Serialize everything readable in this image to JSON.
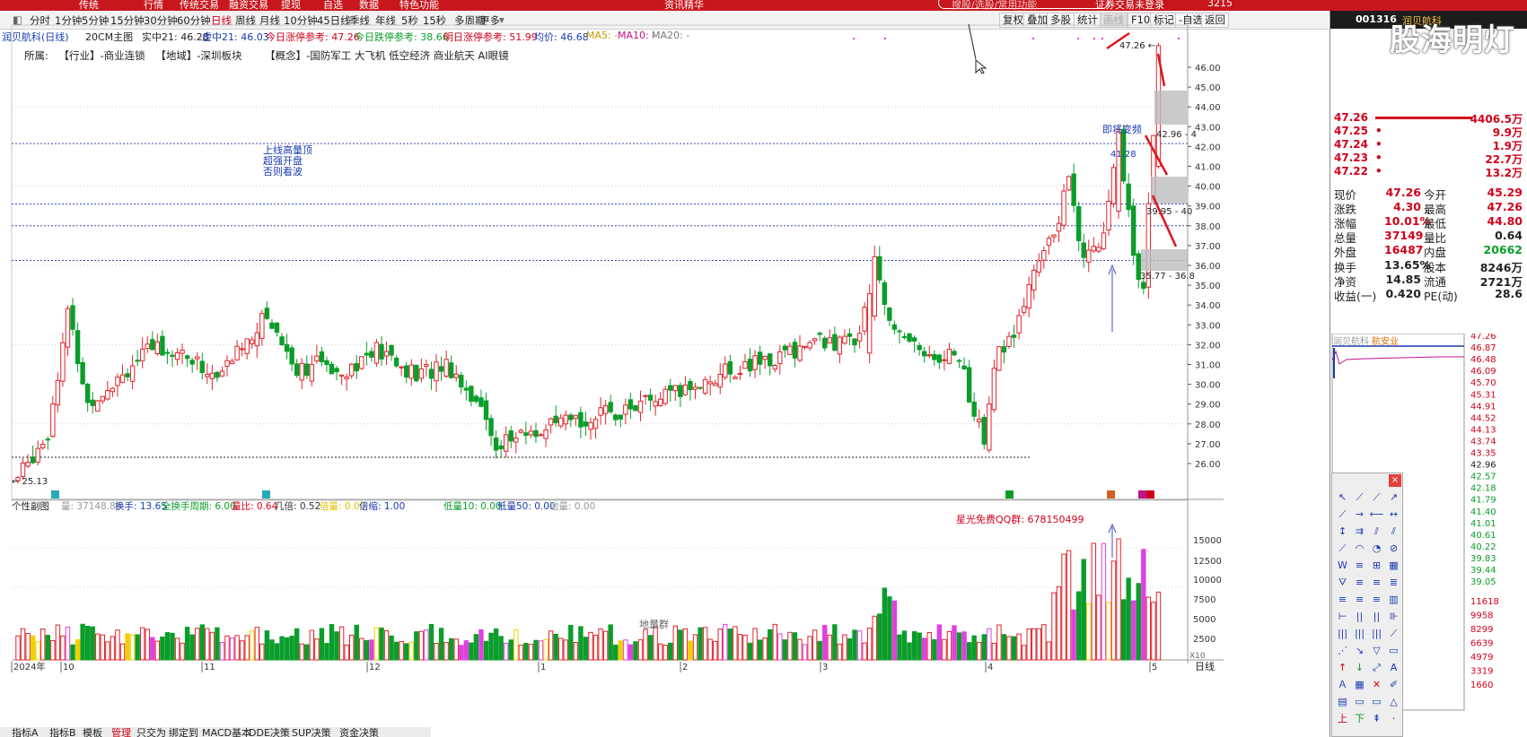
{
  "topbar": {
    "items": [
      "传统",
      "行情",
      "传统交易",
      "融资交易",
      "提现",
      "自选",
      "数据",
      "特色功能"
    ],
    "center_title": "资讯精华",
    "search_placeholder": "搜股/选股/常用功能",
    "login_label": "证券交易未登录",
    "code_prefix": "3215"
  },
  "toolbar": {
    "periods": [
      "分时",
      "1分钟",
      "5分钟",
      "15分钟",
      "30分钟",
      "60分钟",
      "日线",
      "周线",
      "月线",
      "10分钟",
      "45日线",
      "季线",
      "年线",
      "5秒",
      "15秒",
      "多周期",
      "更多"
    ],
    "active_period": "日线",
    "right_buttons": [
      "复权",
      "叠加",
      "多股",
      "统计",
      "画线",
      "F10",
      "标记",
      "-自选",
      "返回"
    ]
  },
  "infobar": {
    "stock_name": "润贝航科(日线)",
    "main_indicator": "20CM主图",
    "shizhong": "实中21: 46.28",
    "xuzhong": "虚中21: 46.03",
    "today_limit_up": "今日涨停参考: 47.26",
    "today_limit_down": "今日跌停参考: 38.66",
    "tomorrow_limit_up": "明日涨停参考: 51.99",
    "avg_price": "均价: 46.68",
    "ma5": "MA5: -",
    "ma10": "MA10: -",
    "ma20": "MA20: -"
  },
  "sector": {
    "label": "所属:",
    "industry": "【行业】-商业连锁",
    "region": "【地域】-深圳板块",
    "concepts": "【概念】-国防军工 大飞机 低空经济 商业航天 AI眼镜"
  },
  "annotations": {
    "note_line1": "上线高量顶",
    "note_line2": "超强开盘",
    "note_line3": "否则看波",
    "about_to_change": "即将变频",
    "high_label": "47.26",
    "peak_label": "41.28",
    "low_label": "25.13",
    "zone1": "42.96 - 4",
    "zone2": "39.95 - 40",
    "zone3": "35.77 - 36.8",
    "qq": "星光免费QQ群: 678150499",
    "dilianqun": "地量群"
  },
  "price_axis": [
    "46.00",
    "45.00",
    "44.00",
    "43.00",
    "42.00",
    "41.00",
    "40.00",
    "39.00",
    "38.00",
    "37.00",
    "36.00",
    "35.00",
    "34.00",
    "33.00",
    "32.00",
    "31.00",
    "30.00",
    "29.00",
    "28.00",
    "27.00",
    "26.00"
  ],
  "volume_axis": [
    "15000",
    "12500",
    "10000",
    "7500",
    "5000",
    "2500"
  ],
  "volume_unit": "X10",
  "date_axis": [
    "2024年",
    "10",
    "11",
    "12",
    "1",
    "2",
    "3",
    "4",
    "5"
  ],
  "subchart": {
    "title": "个性副图",
    "volume": "量: 37148.86",
    "turnover": "换手: 13.65",
    "full_cycle": "全换手周期: 6.00",
    "vol_ratio": "量比: 0.64",
    "multiple": "几倍: 0.52",
    "times_vol": "倍量: 0.00",
    "shrink": "倍缩: 1.00",
    "low10": "低量10: 0.00",
    "low50": "低量50: 0.00",
    "dilian": "地量: 0.00"
  },
  "bottom_tabs": [
    "指标A",
    "指标B",
    "模板",
    "管理",
    "只交为",
    "绑定到",
    "MACD基本",
    "DDE决策",
    "SUP决策",
    "资金决策"
  ],
  "period_label": "日线",
  "right_panel": {
    "code": "001316",
    "name": "润贝航科",
    "order_book": [
      {
        "price": "47.26",
        "bar": true,
        "vol": "4406.5万"
      },
      {
        "price": "47.25",
        "bar": false,
        "vol": "9.9万"
      },
      {
        "price": "47.24",
        "bar": false,
        "vol": "1.9万"
      },
      {
        "price": "47.23",
        "bar": false,
        "vol": "22.7万"
      },
      {
        "price": "47.22",
        "bar": false,
        "vol": "13.2万"
      }
    ],
    "quote": [
      [
        "现价",
        "47.26",
        "今开",
        "45.29"
      ],
      [
        "涨跌",
        "4.30",
        "最高",
        "47.26"
      ],
      [
        "涨幅",
        "10.01%",
        "最低",
        "44.80"
      ],
      [
        "总量",
        "37149",
        "量比",
        "0.64"
      ],
      [
        "外盘",
        "16487",
        "内盘",
        "20662"
      ],
      [
        "换手",
        "13.65%",
        "股本",
        "8246万"
      ],
      [
        "净资",
        "14.85",
        "流通",
        "2721万"
      ],
      [
        "收益(一)",
        "0.420",
        "PE(动)",
        "28.6"
      ]
    ],
    "mini_title": "润贝航科",
    "mini_tag": "航安业",
    "mini_axis": [
      "47.26",
      "46.87",
      "46.48",
      "46.09",
      "45.70",
      "45.31",
      "44.91",
      "44.52",
      "44.13",
      "43.74",
      "43.35",
      "42.96",
      "42.57",
      "42.18",
      "41.79",
      "41.40",
      "41.01",
      "40.61",
      "40.22",
      "39.83",
      "39.44",
      "39.05",
      "11618",
      "9958",
      "8299",
      "6639",
      "4979",
      "3319",
      "1660"
    ]
  },
  "watermark": "股海明灯",
  "colors": {
    "up": "#e0242b",
    "down": "#0a9d2a",
    "accent": "#c8161d"
  }
}
